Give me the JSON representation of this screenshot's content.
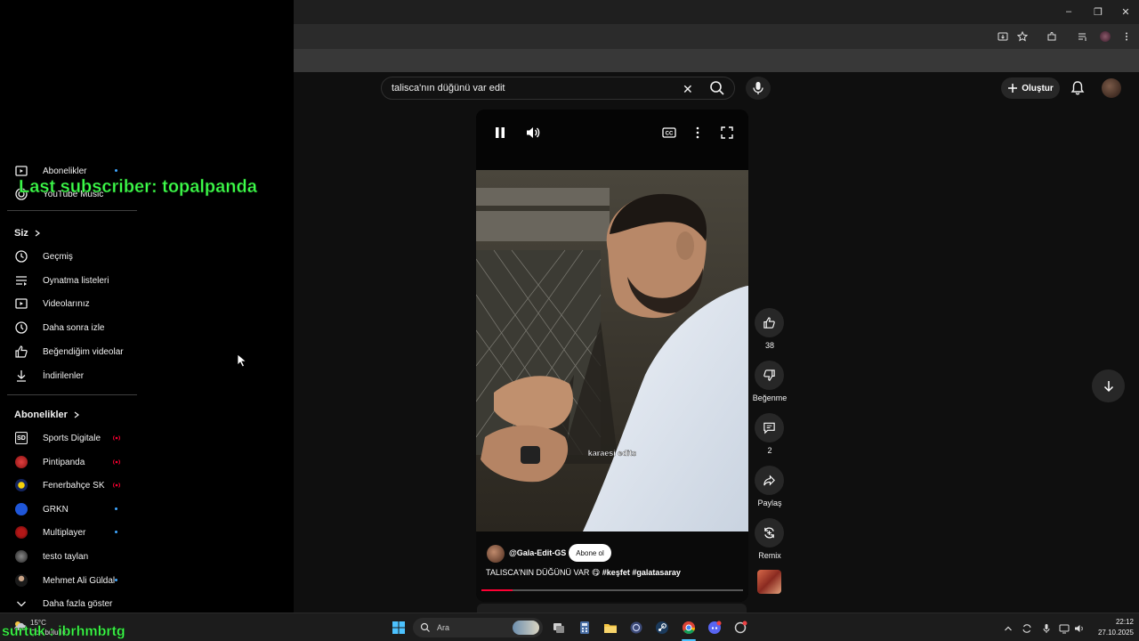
{
  "sidebar": {
    "subscriptions_item": "Abonelikler",
    "music_item": "YouTube Music",
    "you_heading": "Siz",
    "you_items": [
      {
        "label": "Geçmiş",
        "icon": "history-icon"
      },
      {
        "label": "Oynatma listeleri",
        "icon": "playlist-icon"
      },
      {
        "label": "Videolarınız",
        "icon": "your-videos-icon"
      },
      {
        "label": "Daha sonra izle",
        "icon": "watch-later-icon"
      },
      {
        "label": "Beğendiğim videolar",
        "icon": "liked-icon"
      },
      {
        "label": "İndirilenler",
        "icon": "download-icon"
      }
    ],
    "subs_heading": "Abonelikler",
    "channels": [
      {
        "name": "Sports Digitale",
        "status": "live"
      },
      {
        "name": "Pintipanda",
        "status": "live"
      },
      {
        "name": "Fenerbahçe SK",
        "status": "live"
      },
      {
        "name": "GRKN",
        "status": "new"
      },
      {
        "name": "Multiplayer",
        "status": "new"
      },
      {
        "name": "testo taylan",
        "status": "none"
      },
      {
        "name": "Mehmet Ali Güldal",
        "status": "new"
      }
    ],
    "show_more": "Daha fazla göster"
  },
  "overlays": {
    "last_subscriber": "Last subscriber: topalpanda",
    "bottom_ticker": "surtuk : ibrhmbrtg"
  },
  "header": {
    "search_query": "talisca'nın düğünü var edit",
    "create_label": "Oluştur"
  },
  "short": {
    "watermark": "karaesi edits",
    "channel": "@Gala-Edit-GS",
    "subscribe_label": "Abone ol",
    "caption_text": "TALISCA'NIN DÜĞÜNÜ VAR 😋",
    "caption_tags": "#keşfet #galatasaray",
    "progress": 0.12
  },
  "actions": {
    "likes": "38",
    "dislike_label": "Beğenme",
    "comments": "2",
    "share_label": "Paylaş",
    "remix_label": "Remix"
  },
  "taskbar": {
    "search_placeholder": "Ara",
    "weather_temp": "15°C",
    "weather_desc": "Çok bulutlu",
    "time": "22:12",
    "date": "27.10.2025"
  },
  "colors": {
    "accent_red": "#ff0033",
    "overlay_green": "#3dff4b",
    "link_blue": "#3ea6ff"
  }
}
